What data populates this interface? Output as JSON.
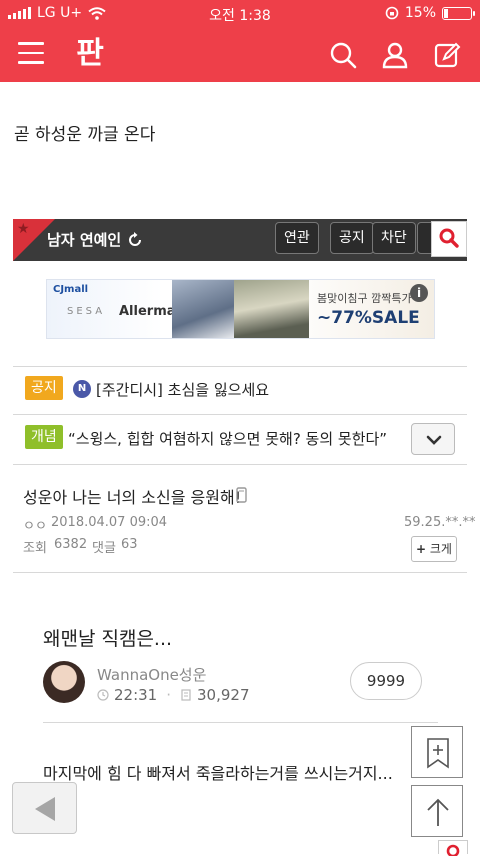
{
  "status_bar": {
    "carrier": "LG U+",
    "time": "오전 1:38",
    "battery": "15%",
    "battery_level": 0.15
  },
  "app_bar": {
    "logo": "판",
    "icons": [
      "menu-icon",
      "search-icon",
      "user-icon",
      "edit-icon"
    ]
  },
  "post": {
    "text": "곧 하성운 까글 온다"
  },
  "board": {
    "title": "남자 연예인",
    "chips": [
      "연관",
      "공지",
      "차단"
    ]
  },
  "ad": {
    "brand": "CJmall",
    "sesa": "SESA",
    "product": "Allerman",
    "subtitle": "봄맞이침구 깜짝특가",
    "sale": "~77%SALE"
  },
  "notice": {
    "tag": "공지",
    "badge": "N",
    "text": "[주간디시] 초심을 잃으세요"
  },
  "concept": {
    "tag": "개념",
    "text": "“스윙스, 힙합 여혐하지 않으면 못해? 동의 못한다”"
  },
  "post_item": {
    "title": "성운아 나는 너의 소신을 응원해!",
    "author": "ㅇㅇ",
    "date": "2018.04.07 09:04",
    "ip": "59.25.**.**",
    "views_label": "조회",
    "views": "6382",
    "comments_label": "댓글",
    "comments": "63",
    "bigger_label": "크게"
  },
  "card": {
    "title": "왜맨날 직캠은...",
    "author": "WannaOne성운",
    "time": "22:31",
    "count": "30,927",
    "likes": "9999",
    "next_title": "마지막에 힘 다 빠져서 죽을라하는거를 쓰시는거지..."
  },
  "colors": {
    "brand": "#ee3f49",
    "notice_tag": "#f1a81e",
    "concept_tag": "#8fbf2a"
  }
}
